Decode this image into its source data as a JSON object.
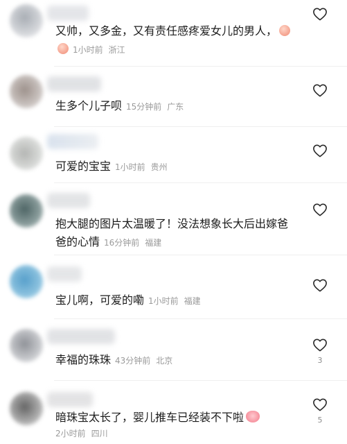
{
  "comments": [
    {
      "text": "又帅，又多金，又有责任感疼爱女儿的男人，",
      "time": "1小时前",
      "location": "浙江",
      "likes": "",
      "emoji": [
        "peach-emoji",
        "peach-emoji"
      ]
    },
    {
      "text": "生多个儿子呗",
      "time": "15分钟前",
      "location": "广东",
      "likes": ""
    },
    {
      "text": "可爱的宝宝",
      "time": "1小时前",
      "location": "贵州",
      "likes": ""
    },
    {
      "text": "抱大腿的图片太温暖了！没法想象长大后出嫁爸爸的心情",
      "time": "16分钟前",
      "location": "福建",
      "likes": ""
    },
    {
      "text": "宝儿啊，可爱的嘞",
      "time": "1小时前",
      "location": "福建",
      "likes": ""
    },
    {
      "text": "幸福的珠珠",
      "time": "43分钟前",
      "location": "北京",
      "likes": "3"
    },
    {
      "text": "暗珠宝太长了，婴儿推车已经装不下啦",
      "time": "2小时前",
      "location": "四川",
      "likes": "5",
      "emoji": [
        "pig-emoji"
      ]
    }
  ],
  "colors": {
    "text": "#1c1c1c",
    "meta": "#9a9a9a",
    "heart_outline": "#2a2a2a"
  },
  "icons": {
    "like": "heart-outline-icon"
  }
}
